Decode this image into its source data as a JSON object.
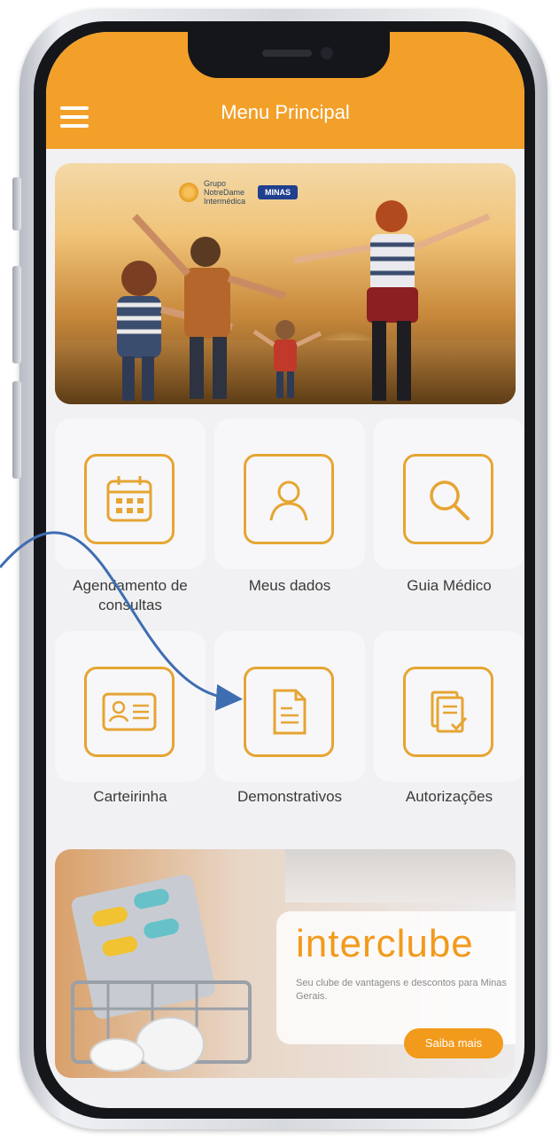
{
  "header": {
    "title": "Menu Principal"
  },
  "banner": {
    "brand_small": "Grupo",
    "brand_line1": "NotreDame",
    "brand_line2": "Intermédica",
    "brand_badge": "MINAS"
  },
  "tiles": [
    {
      "label": "Agendamento de consultas",
      "icon": "calendar-icon"
    },
    {
      "label": "Meus dados",
      "icon": "user-icon"
    },
    {
      "label": "Guia Médico",
      "icon": "search-icon"
    },
    {
      "label": "Carteirinha",
      "icon": "id-card-icon"
    },
    {
      "label": "Demonstrativos",
      "icon": "document-icon"
    },
    {
      "label": "Autorizações",
      "icon": "authorization-icon"
    }
  ],
  "promo": {
    "title": "interclube",
    "text": "Seu clube de vantagens e descontos para Minas Gerais.",
    "button": "Saiba mais"
  },
  "colors": {
    "accent": "#f2a02a",
    "arrow": "#3f6db1",
    "badge": "#1f3f8f"
  }
}
